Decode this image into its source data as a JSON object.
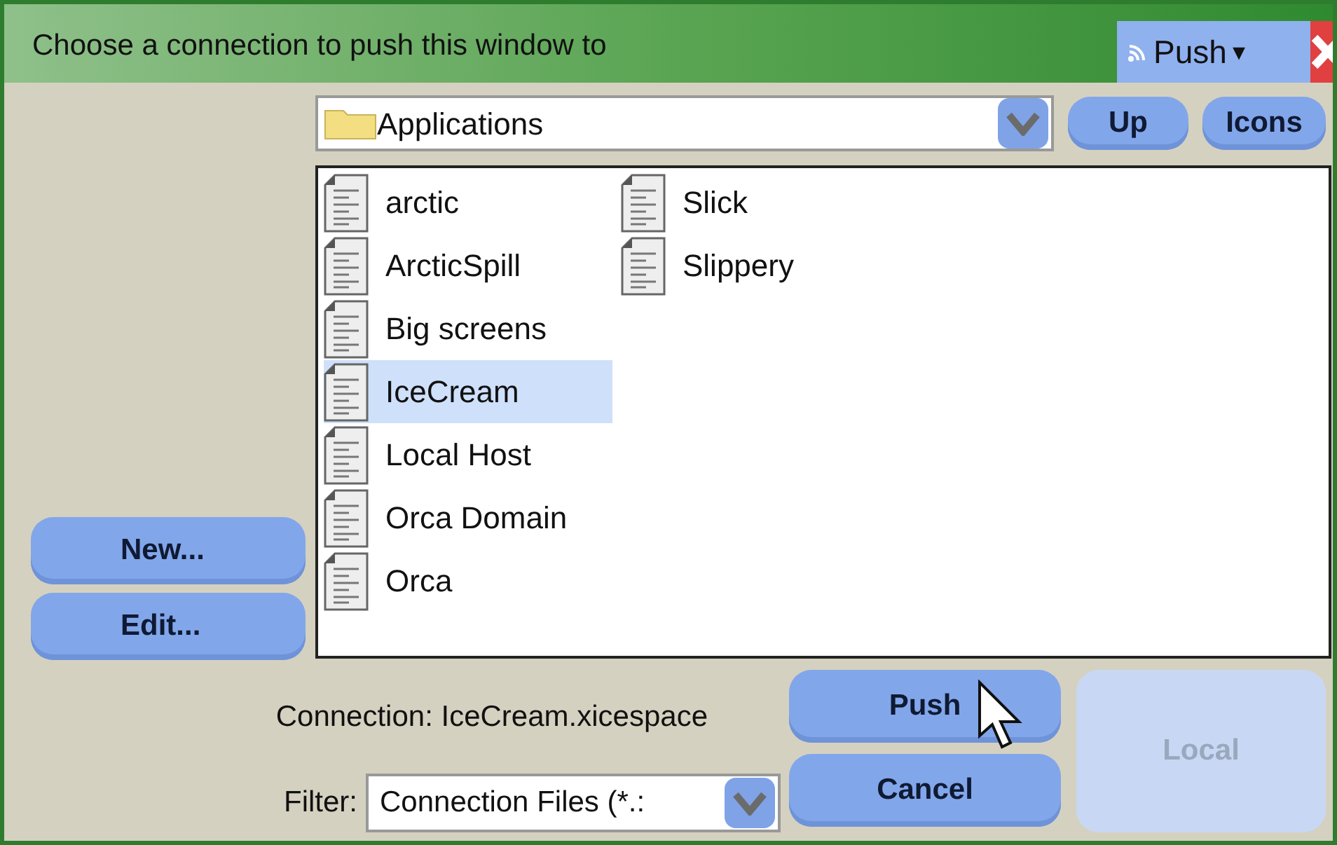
{
  "window": {
    "title": "Choose a connection to push this window to",
    "menu_button": "Push",
    "menu_arrow": "▾"
  },
  "location": {
    "value": "Applications"
  },
  "nav_buttons": [
    "Up",
    "Icons"
  ],
  "side_buttons": [
    "New...",
    "Edit..."
  ],
  "files": [
    {
      "name": "arctic",
      "selected": false
    },
    {
      "name": "ArcticSpill",
      "selected": false
    },
    {
      "name": "Big screens",
      "selected": false
    },
    {
      "name": "IceCream",
      "selected": true
    },
    {
      "name": "Local Host",
      "selected": false
    },
    {
      "name": "Orca Domain",
      "selected": false
    },
    {
      "name": "Orca",
      "selected": false
    },
    {
      "name": "Slick",
      "selected": false
    },
    {
      "name": "Slippery",
      "selected": false
    }
  ],
  "connection": "Connection: IceCream.xicespace",
  "filter": {
    "label": "Filter:",
    "value": "Connection Files (*.:"
  },
  "actions": [
    {
      "label": "Push",
      "disabled": false
    },
    {
      "label": "Cancel",
      "disabled": false
    },
    {
      "label": "Local",
      "disabled": true
    }
  ]
}
